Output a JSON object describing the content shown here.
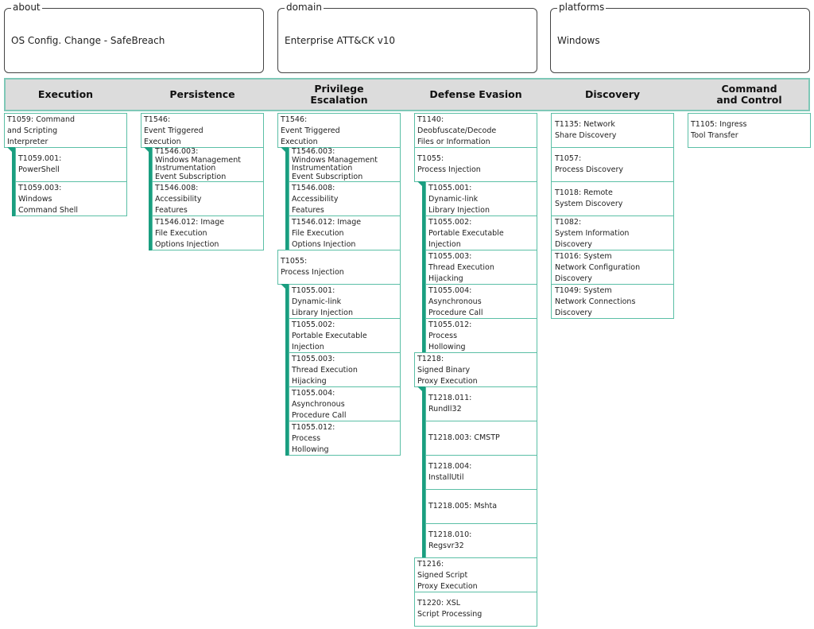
{
  "meta": {
    "about": {
      "legend": "about",
      "value": "OS Config. Change - SafeBreach"
    },
    "domain": {
      "legend": "domain",
      "value": "Enterprise ATT&CK v10"
    },
    "platforms": {
      "legend": "platforms",
      "value": "Windows"
    }
  },
  "colors": {
    "accent": "#1a9e80",
    "border": "#5bbfa6",
    "header_bg": "#dcdcdc"
  },
  "tactics": [
    {
      "name": "Execution",
      "techniques": [
        {
          "label": "T1059: Command\nand Scripting\nInterpreter",
          "subs": [
            {
              "label": "T1059.001:\nPowerShell"
            },
            {
              "label": "T1059.003:\nWindows\nCommand Shell"
            }
          ]
        }
      ]
    },
    {
      "name": "Persistence",
      "techniques": [
        {
          "label": "T1546:\nEvent Triggered\nExecution",
          "subs": [
            {
              "label": "T1546.003:\nWindows Management\nInstrumentation\nEvent Subscription",
              "dense": true
            },
            {
              "label": "T1546.008:\nAccessibility\nFeatures"
            },
            {
              "label": "T1546.012: Image\nFile Execution\nOptions Injection"
            }
          ]
        }
      ]
    },
    {
      "name": "Privilege\nEscalation",
      "techniques": [
        {
          "label": "T1546:\nEvent Triggered\nExecution",
          "subs": [
            {
              "label": "T1546.003:\nWindows Management\nInstrumentation\nEvent Subscription",
              "dense": true
            },
            {
              "label": "T1546.008:\nAccessibility\nFeatures"
            },
            {
              "label": "T1546.012: Image\nFile Execution\nOptions Injection"
            }
          ]
        },
        {
          "label": "T1055:\nProcess Injection",
          "subs": [
            {
              "label": "T1055.001:\nDynamic-link\nLibrary Injection"
            },
            {
              "label": "T1055.002:\nPortable Executable\nInjection"
            },
            {
              "label": "T1055.003:\nThread Execution\nHijacking"
            },
            {
              "label": "T1055.004:\nAsynchronous\nProcedure Call"
            },
            {
              "label": "T1055.012:\nProcess\nHollowing"
            }
          ]
        }
      ]
    },
    {
      "name": "Defense Evasion",
      "techniques": [
        {
          "label": "T1140:\nDeobfuscate/Decode\nFiles or Information",
          "subs": []
        },
        {
          "label": "T1055:\nProcess Injection",
          "subs": [
            {
              "label": "T1055.001:\nDynamic-link\nLibrary Injection"
            },
            {
              "label": "T1055.002:\nPortable Executable\nInjection"
            },
            {
              "label": "T1055.003:\nThread Execution\nHijacking"
            },
            {
              "label": "T1055.004:\nAsynchronous\nProcedure Call"
            },
            {
              "label": "T1055.012:\nProcess\nHollowing"
            }
          ]
        },
        {
          "label": "T1218:\nSigned Binary\nProxy Execution",
          "subs": [
            {
              "label": "T1218.011:\nRundll32"
            },
            {
              "label": "T1218.003: CMSTP"
            },
            {
              "label": "T1218.004:\nInstallUtil"
            },
            {
              "label": "T1218.005: Mshta"
            },
            {
              "label": "T1218.010:\nRegsvr32"
            }
          ]
        },
        {
          "label": "T1216:\nSigned Script\nProxy Execution",
          "subs": []
        },
        {
          "label": "T1220: XSL\nScript Processing",
          "subs": []
        }
      ]
    },
    {
      "name": "Discovery",
      "techniques": [
        {
          "label": "T1135: Network\nShare Discovery",
          "subs": []
        },
        {
          "label": "T1057:\nProcess Discovery",
          "subs": []
        },
        {
          "label": "T1018: Remote\nSystem Discovery",
          "subs": []
        },
        {
          "label": "T1082:\nSystem Information\nDiscovery",
          "subs": []
        },
        {
          "label": "T1016: System\nNetwork Configuration\nDiscovery",
          "subs": []
        },
        {
          "label": "T1049: System\nNetwork Connections\nDiscovery",
          "subs": []
        }
      ]
    },
    {
      "name": "Command\nand Control",
      "techniques": [
        {
          "label": "T1105: Ingress\nTool Transfer",
          "subs": []
        }
      ]
    }
  ]
}
